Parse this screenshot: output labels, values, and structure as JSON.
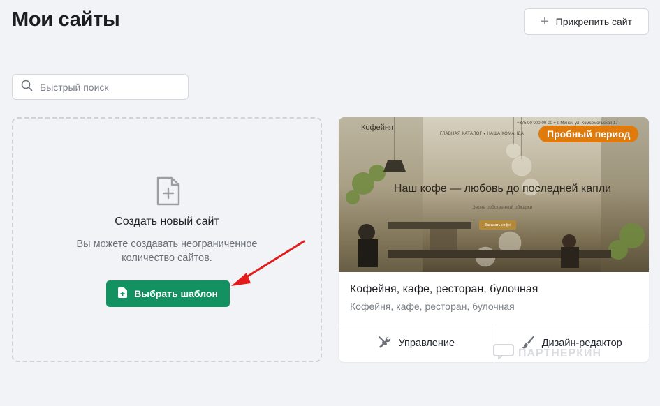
{
  "header": {
    "title": "Мои сайты",
    "attach_label": "Прикрепить сайт"
  },
  "search": {
    "placeholder": "Быстрый поиск",
    "value": ""
  },
  "create_card": {
    "title": "Создать новый сайт",
    "description": "Вы можете создавать неограниченное количество сайтов.",
    "button_label": "Выбрать шаблон"
  },
  "site_card": {
    "preview": {
      "logo": "Кофейня",
      "contact": "+375 00 000-00-00   ⌖ г. Минск, ул. Комсомольская 17",
      "nav": "ГЛАВНАЯ    КАТАЛОГ ▾    НАША КОМАНДА",
      "headline": "Наш кофе — любовь до последней капли",
      "subheadline": "Зерна собственной обжарки",
      "cta": "Заказать кофе"
    },
    "badge": "Пробный период",
    "title": "Кофейня, кафе, ресторан, булочная",
    "subtitle": "Кофейня, кафе, ресторан, булочная",
    "actions": {
      "manage_label": "Управление",
      "design_label": "Дизайн-редактор"
    }
  },
  "watermark": "ПАРТНЕРКИН",
  "colors": {
    "accent_green": "#149160",
    "badge_orange": "#e07a0a",
    "arrow_red": "#e31b1b"
  }
}
